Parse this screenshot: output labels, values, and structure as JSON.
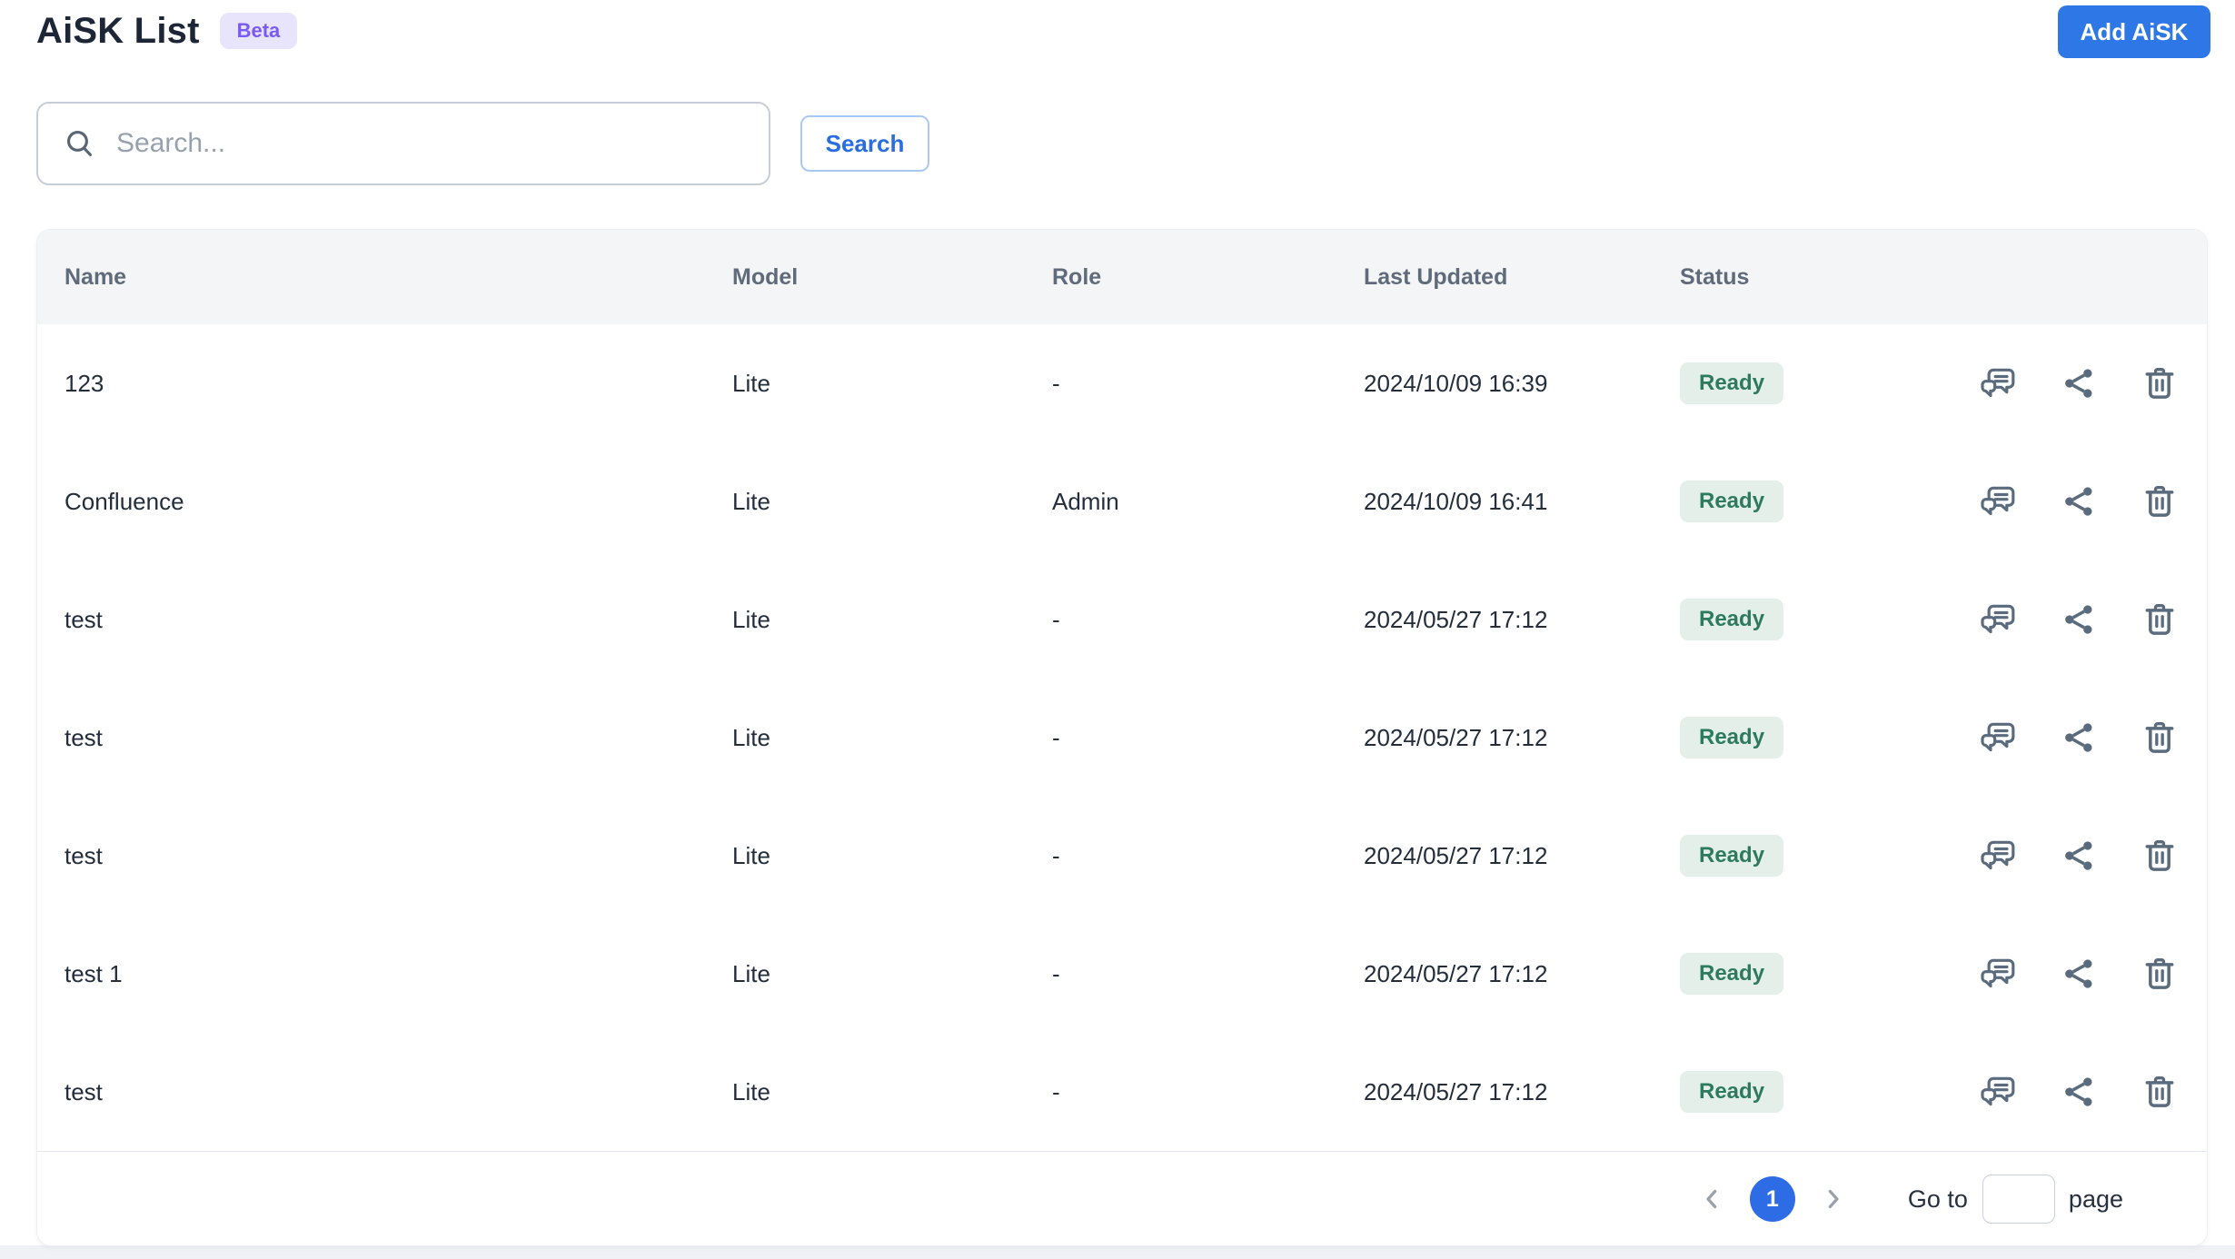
{
  "header": {
    "title": "AiSK List",
    "beta_badge": "Beta",
    "add_button": "Add AiSK"
  },
  "search": {
    "placeholder": "Search...",
    "value": "",
    "button": "Search"
  },
  "table": {
    "columns": {
      "name": "Name",
      "model": "Model",
      "role": "Role",
      "last_updated": "Last Updated",
      "status": "Status"
    },
    "rows": [
      {
        "name": "123",
        "model": "Lite",
        "role": "-",
        "last_updated": "2024/10/09 16:39",
        "status": "Ready"
      },
      {
        "name": "Confluence",
        "model": "Lite",
        "role": "Admin",
        "last_updated": "2024/10/09 16:41",
        "status": "Ready"
      },
      {
        "name": "test",
        "model": "Lite",
        "role": "-",
        "last_updated": "2024/05/27 17:12",
        "status": "Ready"
      },
      {
        "name": "test",
        "model": "Lite",
        "role": "-",
        "last_updated": "2024/05/27 17:12",
        "status": "Ready"
      },
      {
        "name": "test",
        "model": "Lite",
        "role": "-",
        "last_updated": "2024/05/27 17:12",
        "status": "Ready"
      },
      {
        "name": "test 1",
        "model": "Lite",
        "role": "-",
        "last_updated": "2024/05/27 17:12",
        "status": "Ready"
      },
      {
        "name": "test",
        "model": "Lite",
        "role": "-",
        "last_updated": "2024/05/27 17:12",
        "status": "Ready"
      }
    ],
    "row_action_icons": [
      "chat-icon",
      "share-icon",
      "trash-icon"
    ]
  },
  "pagination": {
    "current_page": "1",
    "goto_label": "Go to",
    "goto_value": "",
    "page_label": "page"
  },
  "colors": {
    "accent_blue": "#2e77e6",
    "search_button_blue": "#2a6ce2",
    "beta_bg": "#e8e4fc",
    "beta_text": "#7a5af5",
    "status_bg": "#e3efe8",
    "status_text": "#2e7a5f",
    "header_bg": "#f4f5f7",
    "icon_gray": "#5b6b7e"
  }
}
